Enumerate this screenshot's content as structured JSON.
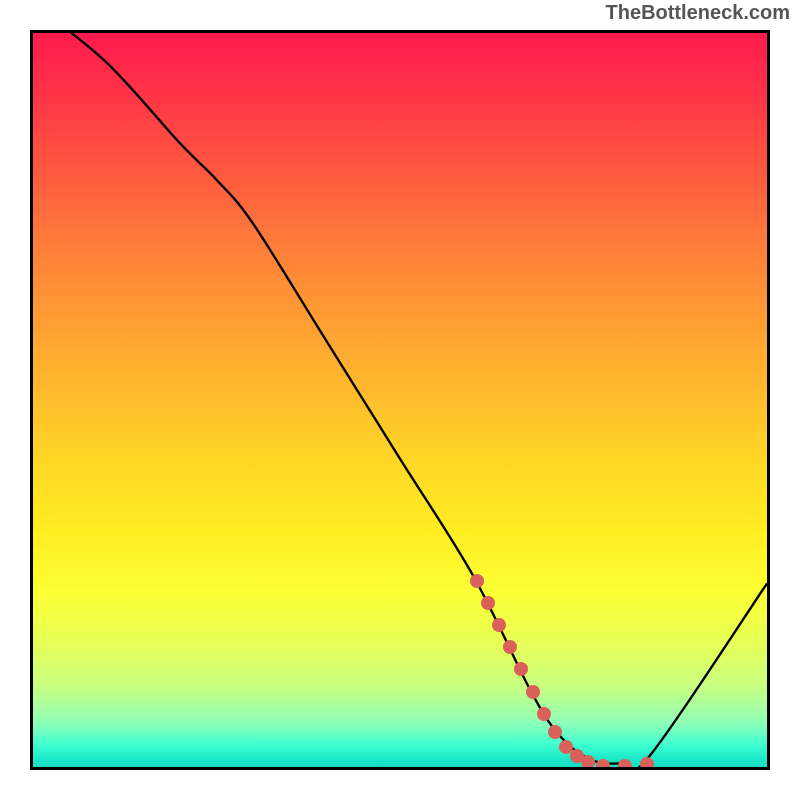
{
  "watermark": "TheBottleneck.com",
  "chart_data": {
    "type": "line",
    "title": "",
    "xlabel": "",
    "ylabel": "",
    "xlim": [
      0,
      100
    ],
    "ylim": [
      0,
      100
    ],
    "grid": false,
    "legend": false,
    "series": [
      {
        "name": "bottleneck-curve",
        "x": [
          0,
          10,
          20,
          25,
          30,
          40,
          50,
          60,
          68,
          72,
          76,
          80,
          84,
          100
        ],
        "values": [
          104,
          96,
          85,
          80,
          74,
          58,
          42,
          26,
          10,
          4,
          1,
          0.5,
          1.5,
          25
        ]
      }
    ],
    "markers": {
      "name": "highlight-dots",
      "color": "#d9615a",
      "points": [
        {
          "x": 60.0,
          "y": 26.0
        },
        {
          "x": 61.5,
          "y": 23.0
        },
        {
          "x": 63.0,
          "y": 20.0
        },
        {
          "x": 64.5,
          "y": 17.0
        },
        {
          "x": 66.0,
          "y": 14.0
        },
        {
          "x": 67.5,
          "y": 11.0
        },
        {
          "x": 69.0,
          "y": 8.0
        },
        {
          "x": 70.5,
          "y": 5.5
        },
        {
          "x": 72.0,
          "y": 3.5
        },
        {
          "x": 73.5,
          "y": 2.3
        },
        {
          "x": 75.0,
          "y": 1.5
        },
        {
          "x": 77.0,
          "y": 1.0
        },
        {
          "x": 80.0,
          "y": 1.0
        },
        {
          "x": 83.0,
          "y": 1.2
        }
      ]
    },
    "gradient_stops": [
      {
        "pos": 0,
        "color": "#ff1a4d"
      },
      {
        "pos": 50,
        "color": "#ffd626"
      },
      {
        "pos": 80,
        "color": "#fcff33"
      },
      {
        "pos": 100,
        "color": "#18dcc2"
      }
    ]
  }
}
